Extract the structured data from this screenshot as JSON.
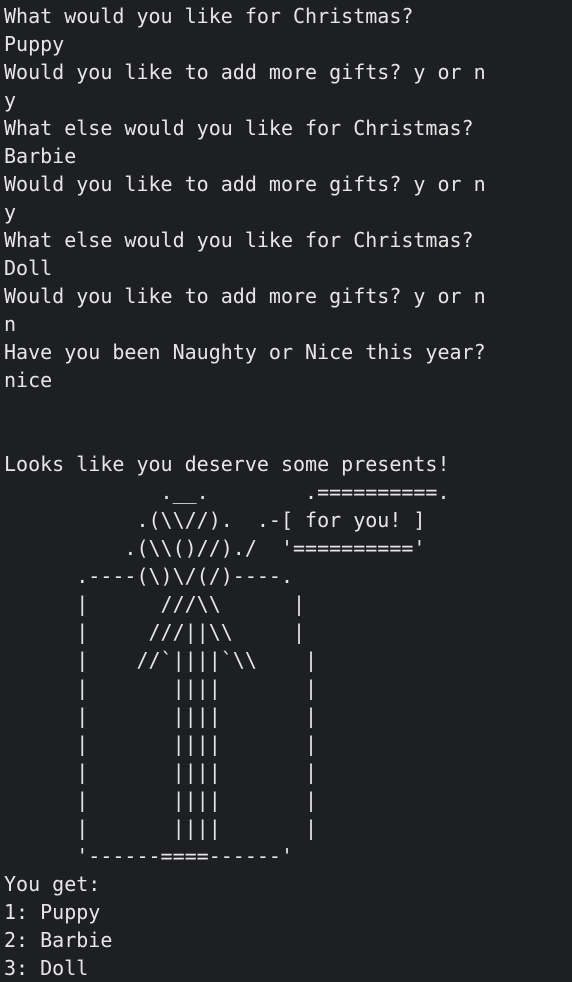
{
  "colors": {
    "background": "#1e1f22",
    "text": "#e6e6e6"
  },
  "session": {
    "intro_lines": [
      "What would you like for Christmas?",
      "Puppy",
      "Would you like to add more gifts? y or n",
      "y",
      "What else would you like for Christmas?",
      "Barbie",
      "Would you like to add more gifts? y or n",
      "y",
      "What else would you like for Christmas?",
      "Doll",
      "Would you like to add more gifts? y or n",
      "n",
      "Have you been Naughty or Nice this year?",
      "nice",
      "",
      "",
      "Looks like you deserve some presents!"
    ],
    "ascii_art": [
      "             .__.        .==========.",
      "           .(\\\\//).  .-[ for you! ]",
      "          .(\\\\()//)./  '=========='",
      "      .----(\\)\\/(/)----.",
      "      |      ///\\\\      |",
      "      |     ///||\\\\     |",
      "      |    //`||||`\\\\    |",
      "      |       ||||       |",
      "      |       ||||       |",
      "      |       ||||       |",
      "      |       ||||       |",
      "      |       ||||       |",
      "      |       ||||       |",
      "      '------====------'"
    ],
    "result_lines": [
      "You get:",
      "1: Puppy",
      "2: Barbie",
      "3: Doll"
    ]
  }
}
